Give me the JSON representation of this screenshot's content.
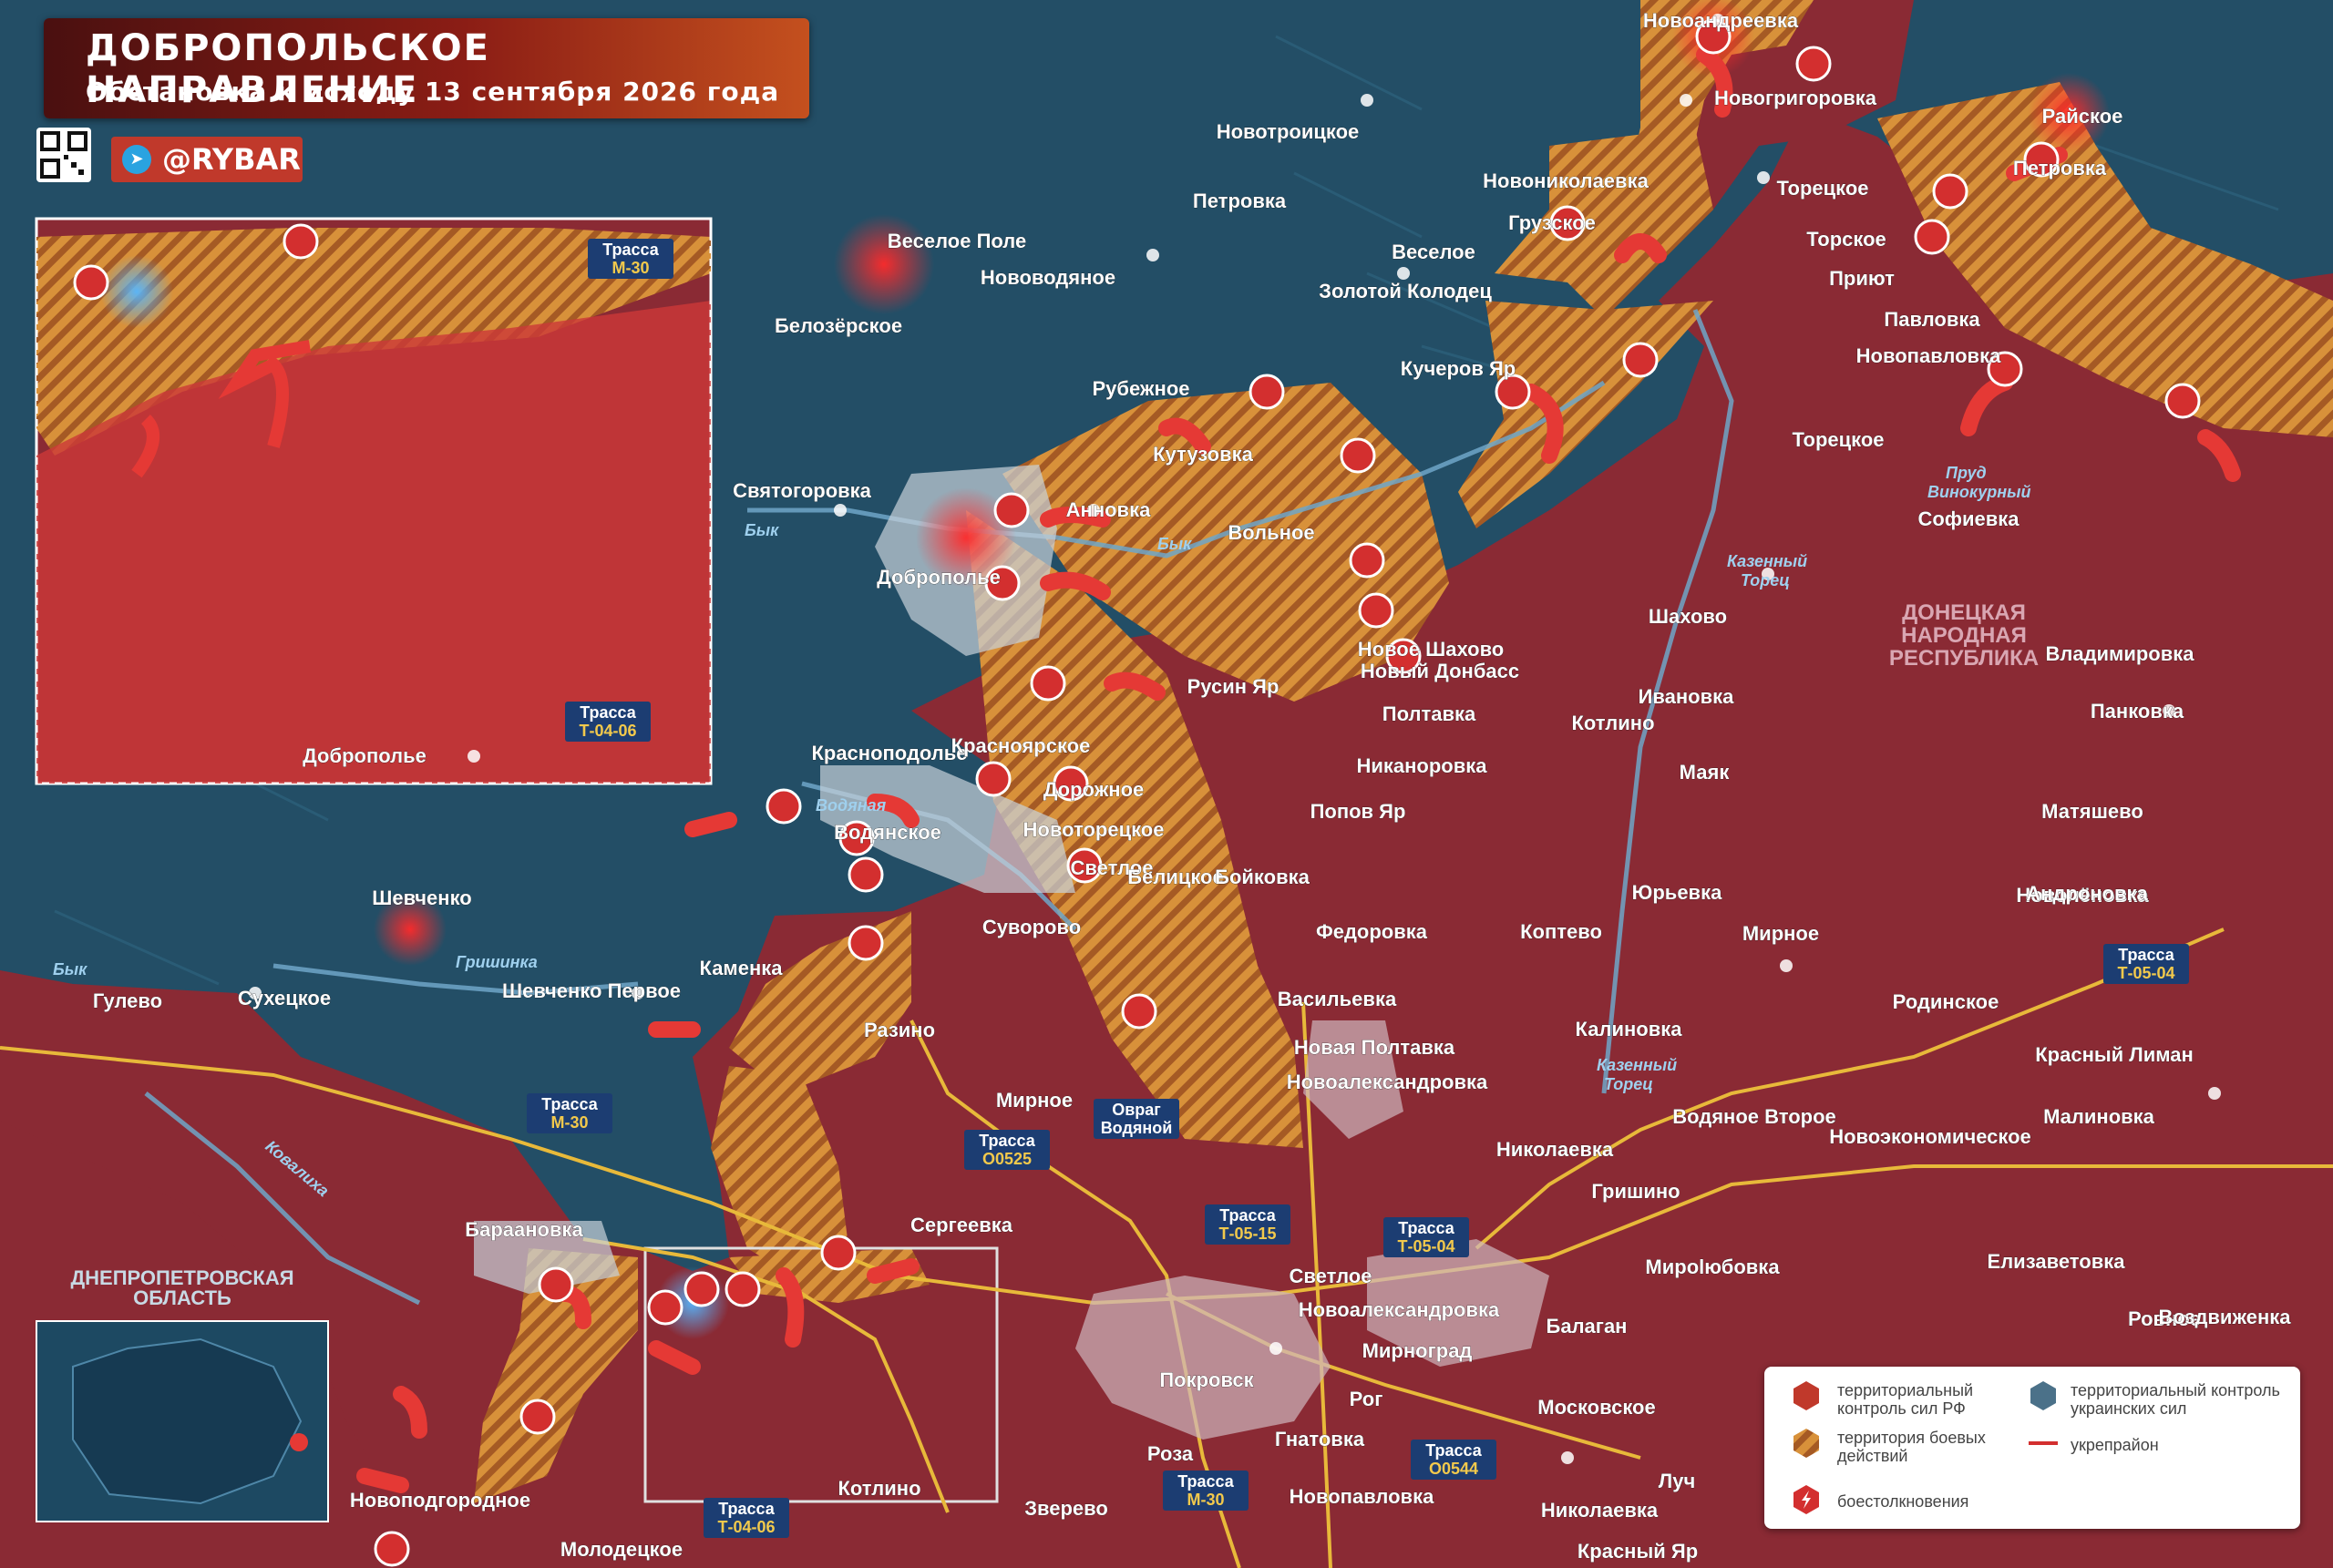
{
  "header": {
    "title": "ДОБРОПОЛЬСКОЕ НАПРАВЛЕНИЕ",
    "subtitle": "Обстановка к исходу 13 сентября 2026 года",
    "brand": "@RYBAR"
  },
  "legend": {
    "ru_control": "территориальный контроль сил РФ",
    "ua_control": "территориальный контроль украинских сил",
    "combat": "территория боевых действий",
    "fortified": "укрепрайон",
    "clashes": "боестолкновения"
  },
  "regions": {
    "dnr": "ДОНЕЦКАЯ НАРОДНАЯ РЕСПУБЛИКА",
    "dnepr": "ДНЕПРОПЕТРОВСКАЯ ОБЛАСТЬ"
  },
  "rivers": [
    "Бык",
    "Бык",
    "Бык",
    "Водяная",
    "Гришинка",
    "Казенный Торец",
    "Казенный Торец",
    "Ковалиха",
    "Пруд Винокурный"
  ],
  "roads": [
    "Трасса М-30",
    "Трасса Т-04-06",
    "Трасса М-30",
    "Трасса О0525",
    "Трасса Т-05-15",
    "Трасса Т-05-04",
    "Трасса Т-05-04",
    "Трасса О0544",
    "Трасса М-30",
    "Трасса Т-04-06",
    "Овраг Водяной"
  ],
  "settlements": [
    "Новоандреевка",
    "Новогригоровка",
    "Райское",
    "Новотроицкое",
    "Новониколаевка",
    "Торецкое",
    "Петровка",
    "Петровка",
    "Грузское",
    "Торское",
    "Веселое Поле",
    "Нововодяное",
    "Веселое",
    "Приют",
    "Белозёрское",
    "Золотой Колодец",
    "Павловка",
    "Новопавловка",
    "Кучеров Яр",
    "Рубежное",
    "Торецкое",
    "Кутузовка",
    "Святогоровка",
    "Анновка",
    "Софиевка",
    "Вольное",
    "Доброполье",
    "Шахово",
    "Новое Шахово",
    "Новый Донбасс",
    "Русин Яр",
    "Владимировка",
    "Ивановка",
    "Полтавка",
    "Панковка",
    "Котлино",
    "Доброполье",
    "Красноподолье",
    "Никаноровка",
    "Маяк",
    "Красноярское",
    "Дорожное",
    "Попов Яр",
    "Матяшево",
    "Водянское",
    "Новоторецкое",
    "Светлое",
    "Белицкое",
    "Бойковка",
    "Новолёновка",
    "Юрьевка",
    "Шевченко",
    "Суворово",
    "Федоровка",
    "Коптево",
    "Мирное",
    "Андроновка",
    "Каменка",
    "Гулево",
    "Сухецкое",
    "Шевченко Первое",
    "Васильевка",
    "Родинское",
    "Разино",
    "Новая Полтавка",
    "Калиновка",
    "Красный Лиман",
    "Новоалександровка",
    "Мирное",
    "Водяное Второе",
    "Малиновка",
    "Новоэкономическое",
    "Николаевка",
    "Гришино",
    "Сергеевка",
    "Бараановка",
    "Елизаветовка",
    "Мироlюбовка",
    "Светлое",
    "Новоалександровка",
    "Ровное",
    "Балаган",
    "Воздвиженка",
    "Мирноград",
    "Покровск",
    "Рог",
    "Московское",
    "Гнатовка",
    "Роза",
    "Луч",
    "Котлино",
    "Новопавловка",
    "Новоподгородное",
    "Зверево",
    "Николаевка",
    "Молодецкое",
    "Красный Яр"
  ]
}
